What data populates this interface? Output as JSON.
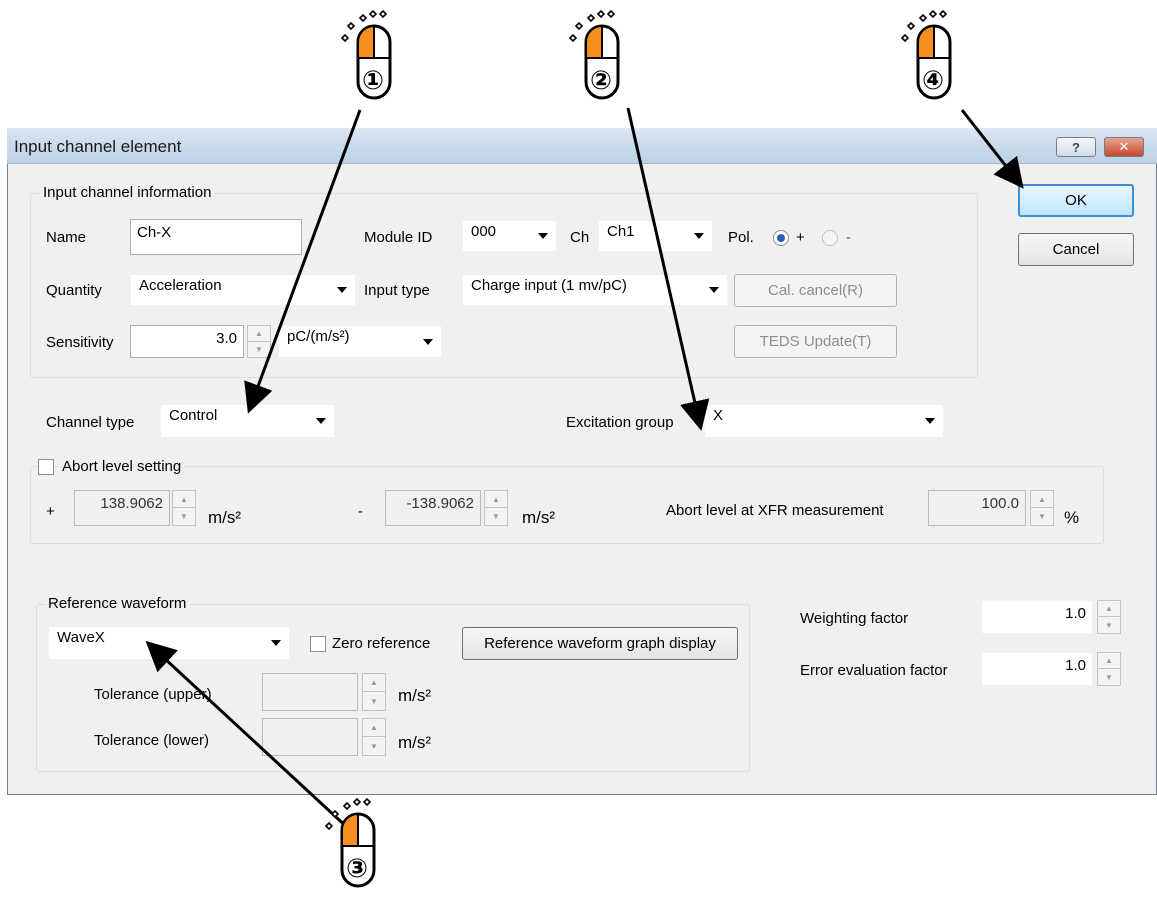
{
  "window": {
    "title": "Input channel element"
  },
  "input_info": {
    "group_label": "Input channel information",
    "name_label": "Name",
    "name_value": "Ch-X",
    "module_label": "Module ID",
    "module_value": "000",
    "ch_label": "Ch",
    "ch_value": "Ch1",
    "pol_label": "Pol.",
    "pol_plus": "+",
    "pol_minus": "-",
    "quantity_label": "Quantity",
    "quantity_value": "Acceleration",
    "input_type_label": "Input type",
    "input_type_value": "Charge input (1 mv/pC)",
    "cal_cancel": "Cal. cancel(R)",
    "sensitivity_label": "Sensitivity",
    "sensitivity_value": "3.0",
    "sensitivity_unit": "pC/(m/s²)",
    "teds_update": "TEDS Update(T)"
  },
  "channel": {
    "type_label": "Channel type",
    "type_value": "Control",
    "excitation_label": "Excitation group",
    "excitation_value": "X"
  },
  "abort": {
    "label": "Abort level setting",
    "plus_sign": "+",
    "plus_value": "138.9062",
    "minus_sign": "-",
    "minus_value": "-138.9062",
    "unit": "m/s²",
    "xfr_label": "Abort level at XFR measurement",
    "xfr_value": "100.0",
    "xfr_unit": "%"
  },
  "reference": {
    "group_label": "Reference waveform",
    "wave_value": "WaveX",
    "zero_ref": "Zero reference",
    "graph_button": "Reference waveform graph display",
    "tol_upper": "Tolerance (upper)",
    "tol_lower": "Tolerance (lower)",
    "unit": "m/s²"
  },
  "factors": {
    "weighting_label": "Weighting factor",
    "weighting_value": "1.0",
    "error_label": "Error evaluation factor",
    "error_value": "1.0"
  },
  "buttons": {
    "ok": "OK",
    "cancel": "Cancel"
  },
  "callouts": [
    "①",
    "②",
    "③",
    "④"
  ],
  "colors": {
    "mouse_accent": "#f5901e",
    "default_button": "#3c8fd6"
  }
}
